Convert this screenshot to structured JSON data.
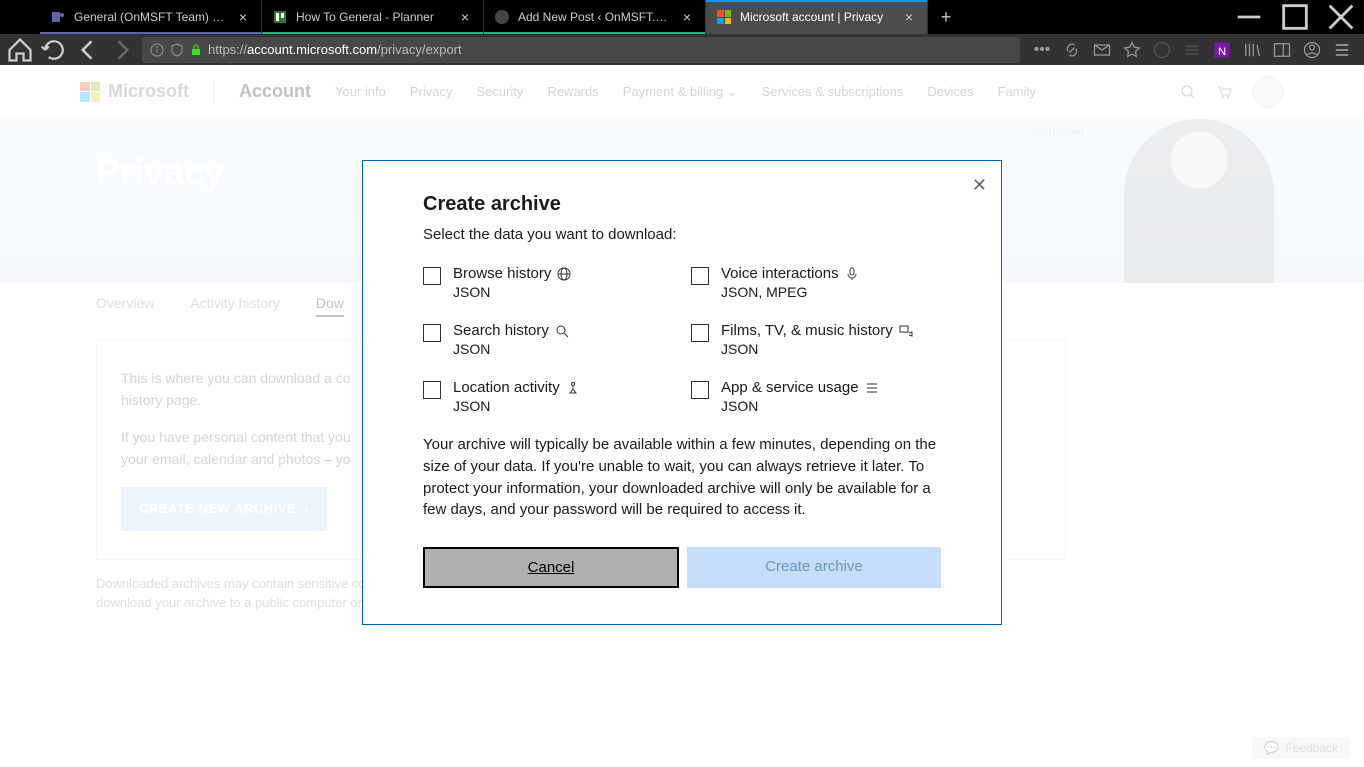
{
  "browser": {
    "tabs": [
      {
        "title": "General (OnMSFT Team) | Micr"
      },
      {
        "title": "How To General - Planner"
      },
      {
        "title": "Add New Post ‹ OnMSFT.com — W"
      },
      {
        "title": "Microsoft account | Privacy"
      }
    ],
    "url_prefix": "https://",
    "url_host": "account.microsoft.com",
    "url_path": "/privacy/export"
  },
  "header": {
    "brand": "Microsoft",
    "account": "Account",
    "links": [
      "Your info",
      "Privacy",
      "Security",
      "Rewards",
      "Payment & billing",
      "Services & subscriptions",
      "Devices",
      "Family"
    ]
  },
  "hero": {
    "title": "Privacy",
    "quote_tail": "controlled"
  },
  "subnav": {
    "items": [
      "Overview",
      "Activity history",
      "Dow"
    ]
  },
  "content": {
    "p1a": "This is where you can download a co",
    "p1b": "history page.",
    "p2a": "If you have personal content that you",
    "p2b": "your email, calendar and photos – yo",
    "cta": "CREATE NEW ARCHIVE",
    "note": "Downloaded archives may contain sensitive content, such as your search history, location information and other personal data. Do not download your archive to a public computer or any other location where others might be able to access it."
  },
  "modal": {
    "title": "Create archive",
    "sub": "Select the data you want to download:",
    "items": [
      {
        "label": "Browse history",
        "fmt": "JSON",
        "icon": "globe"
      },
      {
        "label": "Voice interactions",
        "fmt": "JSON, MPEG",
        "icon": "mic"
      },
      {
        "label": "Search history",
        "fmt": "JSON",
        "icon": "search"
      },
      {
        "label": "Films, TV, & music history",
        "fmt": "JSON",
        "icon": "media"
      },
      {
        "label": "Location activity",
        "fmt": "JSON",
        "icon": "location"
      },
      {
        "label": "App & service usage",
        "fmt": "JSON",
        "icon": "list"
      }
    ],
    "info": "Your archive will typically be available within a few minutes, depending on the size of your data. If you're unable to wait, you can always retrieve it later. To protect your information, your downloaded archive will only be available for a few days, and your password will be required to access it.",
    "cancel": "Cancel",
    "create": "Create archive"
  },
  "feedback": "Feedback"
}
